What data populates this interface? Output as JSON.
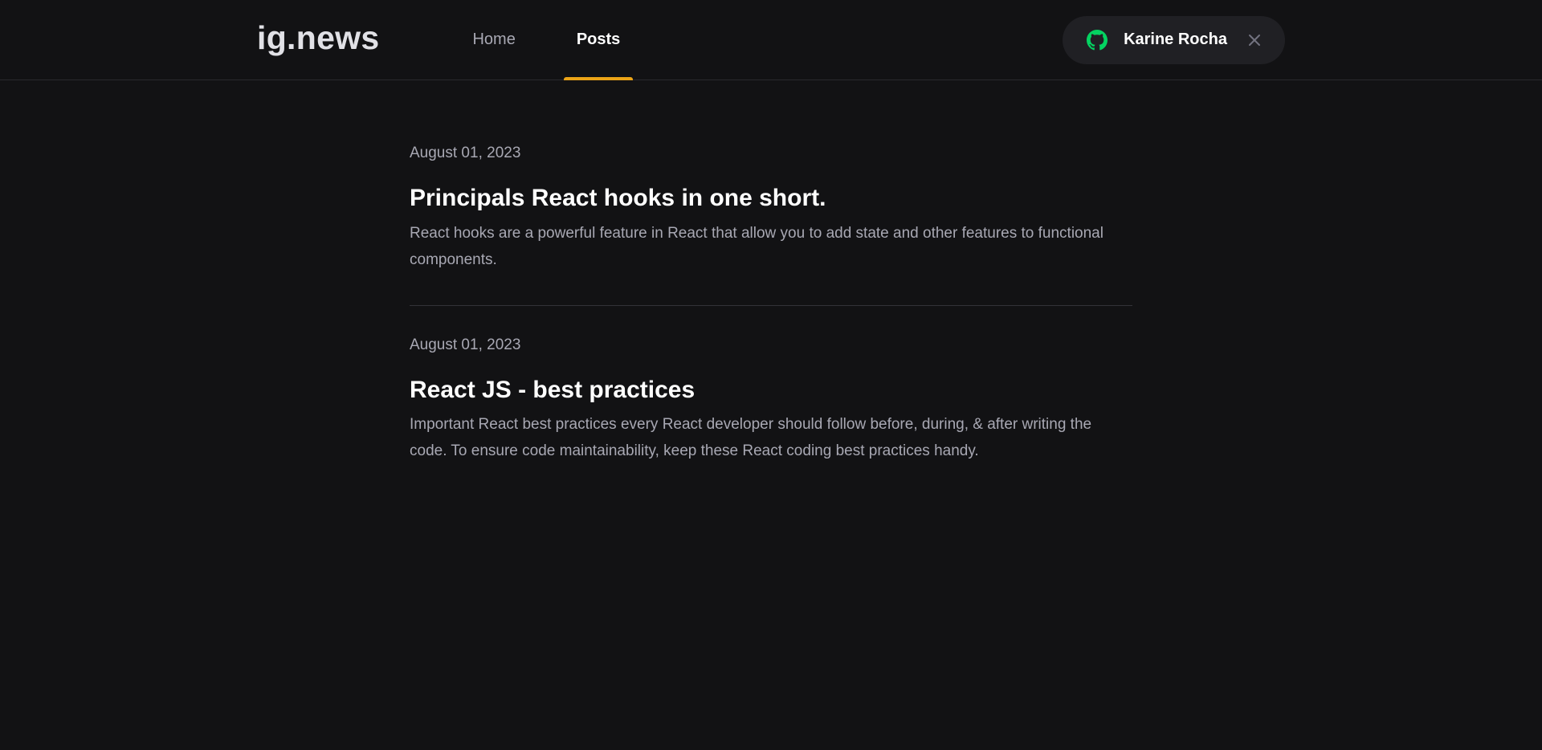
{
  "header": {
    "logo": "ig.news",
    "nav": [
      {
        "label": "Home",
        "active": false
      },
      {
        "label": "Posts",
        "active": true
      }
    ],
    "user": {
      "name": "Karine Rocha",
      "provider_icon": "github-icon",
      "close_icon": "close-icon"
    }
  },
  "colors": {
    "background": "#121214",
    "accent": "#eba417",
    "github_green": "#04d361"
  },
  "posts": [
    {
      "date": "August 01, 2023",
      "title": "Principals React hooks in one short.",
      "excerpt": "React hooks are a powerful feature in React that allow you to add state and other features to functional components."
    },
    {
      "date": "August 01, 2023",
      "title": "React JS - best practices",
      "excerpt": "Important React best practices every React developer should follow before, during, & after writing the code. To ensure code maintainability, keep these React coding best practices handy."
    }
  ]
}
